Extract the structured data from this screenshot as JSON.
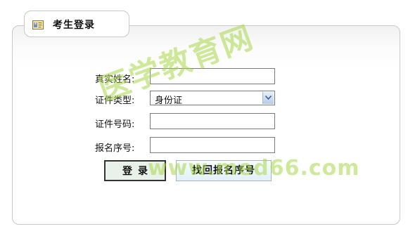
{
  "panel": {
    "title": "考生登录",
    "icon": "user-card-icon"
  },
  "form": {
    "real_name_label": "真实姓名:",
    "real_name_value": "",
    "id_type_label": "证件类型:",
    "id_type_selected": "身份证",
    "id_number_label": "证件号码:",
    "id_number_value": "",
    "serial_label": "报名序号:",
    "serial_value": ""
  },
  "buttons": {
    "login": "登录",
    "find_serial": "找回报名序号"
  },
  "watermark": {
    "cn": "医学教育网",
    "url": "www.med66.com"
  }
}
